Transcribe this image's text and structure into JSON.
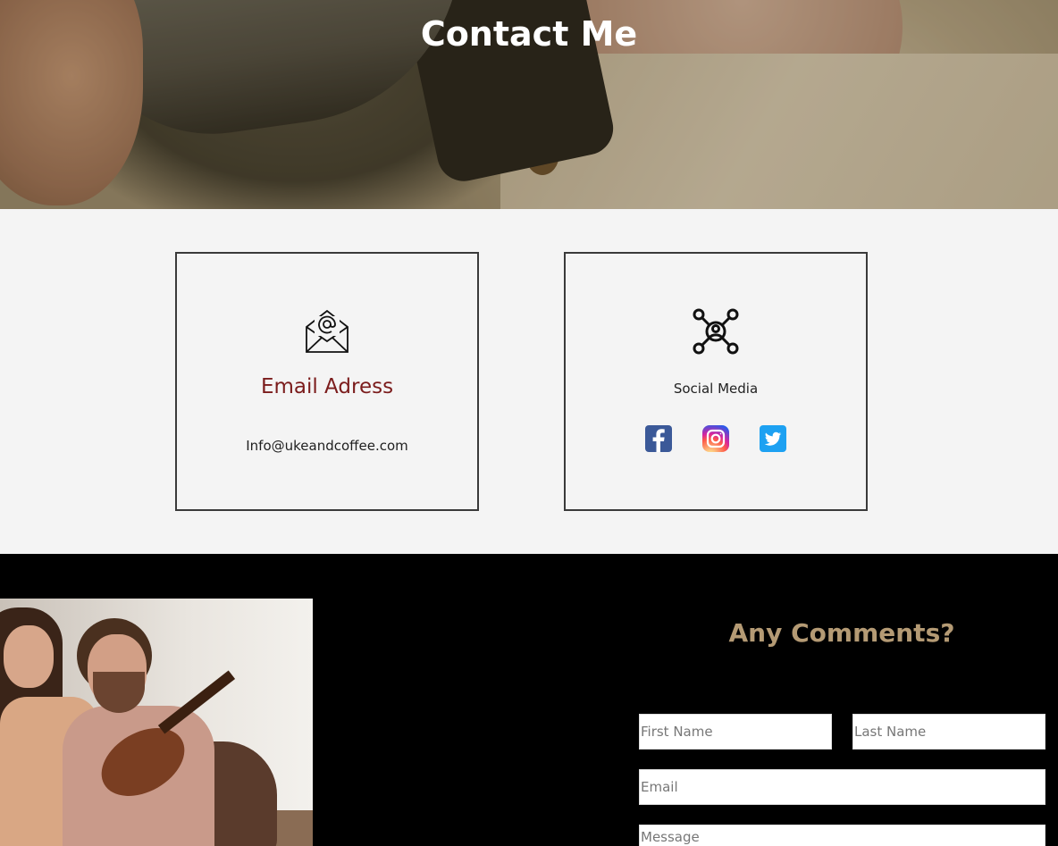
{
  "hero": {
    "title": "Contact Me"
  },
  "contact_cards": {
    "email": {
      "icon": "email-at-icon",
      "title": "Email Adress",
      "value": "Info@ukeandcoffee.com"
    },
    "social": {
      "icon": "network-icon",
      "title": "Social Media",
      "links": [
        {
          "icon": "facebook-icon",
          "color": "#3b5998"
        },
        {
          "icon": "instagram-icon",
          "color": "#e1306c"
        },
        {
          "icon": "twitter-icon",
          "color": "#1da1f2"
        }
      ]
    }
  },
  "comments": {
    "title": "Any Comments?",
    "fields": {
      "first_name": "First Name",
      "last_name": "Last Name",
      "email": "Email",
      "message": "Message"
    }
  },
  "colors": {
    "accent_red": "#7b1c1c",
    "accent_gold": "#b49a74",
    "section_bg": "#f4f4f4",
    "dark_bg": "#000000"
  }
}
